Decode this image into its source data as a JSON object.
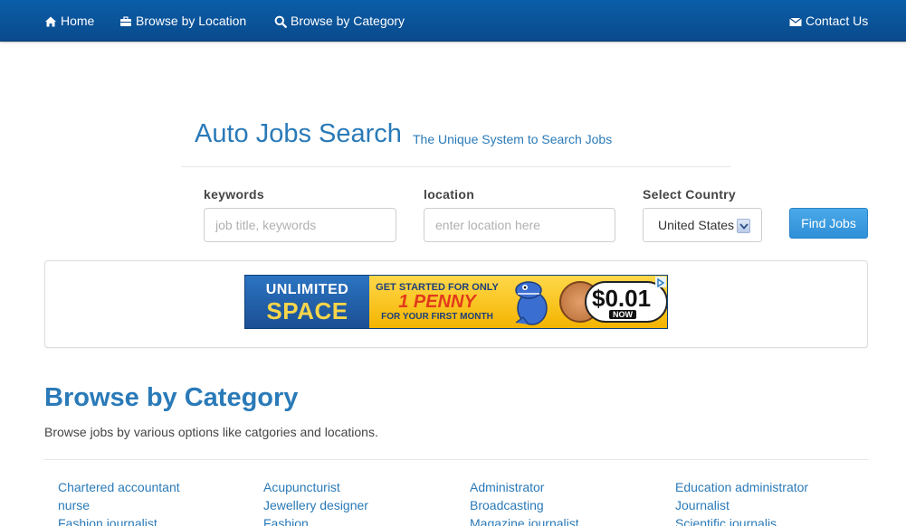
{
  "nav": {
    "home": "Home",
    "browse_location": "Browse by Location",
    "browse_category": "Browse by Category",
    "contact": "Contact Us"
  },
  "header": {
    "title": "Auto Jobs Search",
    "tagline": "The Unique System to Search Jobs"
  },
  "search": {
    "keywords_label": "keywords",
    "keywords_placeholder": "job title, keywords",
    "location_label": "location",
    "location_placeholder": "enter location here",
    "country_label": "Select Country",
    "country_value": "United States",
    "submit_label": "Find Jobs"
  },
  "ad": {
    "line1": "UNLIMITED",
    "line2": "SPACE",
    "promo1": "GET STARTED FOR ONLY",
    "promo2": "1 PENNY",
    "promo3": "FOR YOUR FIRST MONTH",
    "price": "$0.01",
    "now": "NOW"
  },
  "category_section": {
    "title": "Browse by Category",
    "description": "Browse jobs by various options like catgories and locations.",
    "columns": [
      [
        "Chartered accountant",
        "nurse",
        "Fashion journalist"
      ],
      [
        "Acupuncturist",
        "Jewellery designer",
        "Fashion"
      ],
      [
        "Administrator",
        "Broadcasting",
        "Magazine journalist"
      ],
      [
        "Education administrator",
        "Journalist",
        "Scientific journalis"
      ]
    ]
  },
  "colors": {
    "navbar": "#0a5ea8",
    "link": "#2a7ab8",
    "button": "#3a9be0"
  }
}
